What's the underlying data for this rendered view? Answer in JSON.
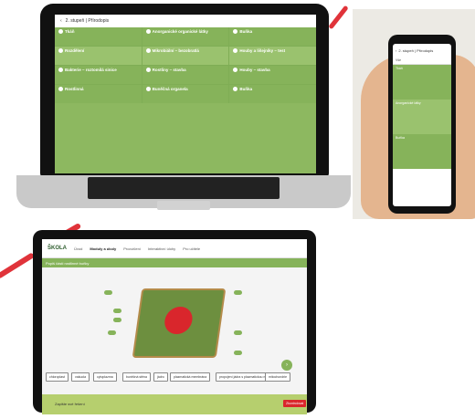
{
  "laptop": {
    "app_title": "2. stupeň | Přírodopis",
    "tiles": [
      {
        "title": "Tkáň",
        "sub": "",
        "alt": false
      },
      {
        "title": "Anorganické organické látky",
        "sub": "",
        "alt": false
      },
      {
        "title": "Buňka",
        "sub": "",
        "alt": false
      },
      {
        "title": "Rozdělení",
        "sub": "",
        "alt": true
      },
      {
        "title": "Mikrobiální – bezobratlá",
        "sub": "",
        "alt": true
      },
      {
        "title": "Houby a lišejníky – test",
        "sub": "",
        "alt": true
      },
      {
        "title": "Bakterie – roztomilá sinice",
        "sub": "",
        "alt": false
      },
      {
        "title": "Rostliny – stavba",
        "sub": "",
        "alt": false
      },
      {
        "title": "Houby – stavba",
        "sub": "",
        "alt": false
      },
      {
        "title": "Rostlinná",
        "sub": "",
        "alt": false
      },
      {
        "title": "Buněčná organela",
        "sub": "",
        "alt": false
      },
      {
        "title": "Buňka",
        "sub": "",
        "alt": false
      }
    ]
  },
  "phone": {
    "title": "2. stupeň | Přírodopis",
    "filter_label": "Vše",
    "rows": [
      "Tkáň",
      "Anorganické látky",
      "Buňka"
    ]
  },
  "tablet": {
    "logo": "ŠKOLA",
    "nav": [
      "Úvod",
      "Moduly a úkoly",
      "Procvičení",
      "Interaktivní úlohy",
      "Pro učitele"
    ],
    "exercise_title": "Popiš části rostlinné buňky",
    "tags": [
      "chloroplast",
      "vakuola",
      "cytoplazma",
      "buněčná stěna",
      "jádro",
      "plazmatická membrána",
      "propojení jádra s plazmatickou membránou",
      "mitochondrie"
    ],
    "check_button": "Zkontrolovat",
    "footer_text": "Zapište své řešení"
  },
  "colors": {
    "accent": "#e0333a",
    "green": "#86b35a",
    "green_light": "#9ac26e"
  }
}
